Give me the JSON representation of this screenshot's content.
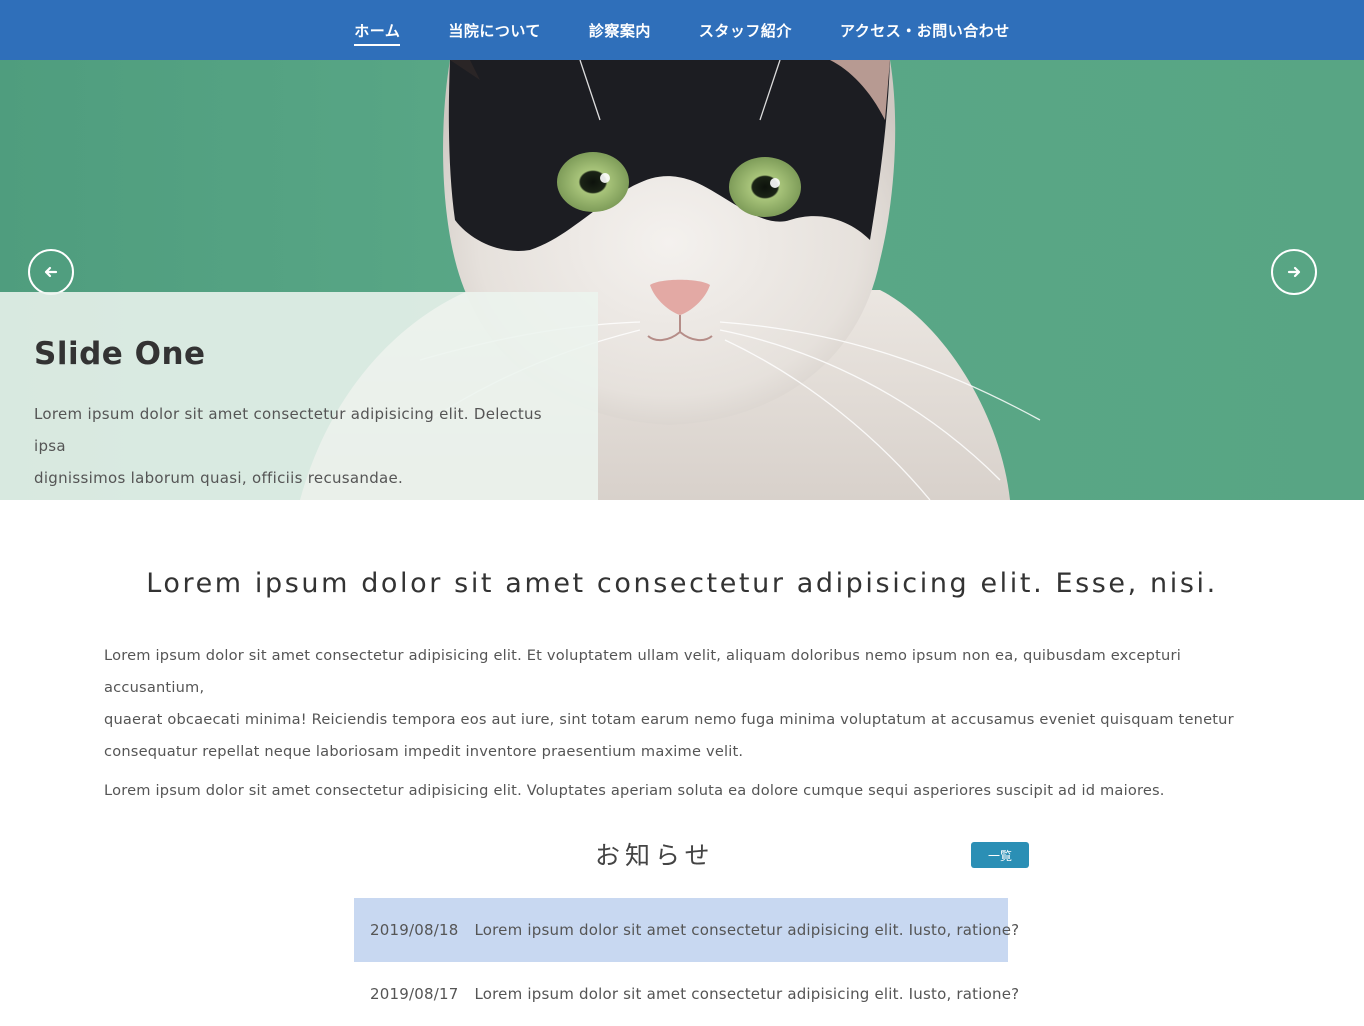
{
  "nav": {
    "items": [
      {
        "label": "ホーム",
        "active": true
      },
      {
        "label": "当院について",
        "active": false
      },
      {
        "label": "診察案内",
        "active": false
      },
      {
        "label": "スタッフ紹介",
        "active": false
      },
      {
        "label": "アクセス・お問い合わせ",
        "active": false
      }
    ]
  },
  "hero": {
    "slide_title": "Slide One",
    "slide_text_line1": "Lorem ipsum dolor sit amet consectetur adipisicing elit. Delectus ipsa",
    "slide_text_line2": "dignissimos laborum quasi, officiis recusandae.",
    "prev_icon": "arrow-left-icon",
    "next_icon": "arrow-right-icon"
  },
  "intro": {
    "heading": "Lorem ipsum dolor sit amet consectetur adipisicing elit. Esse, nisi.",
    "paragraph1_line1": "Lorem ipsum dolor sit amet consectetur adipisicing elit. Et voluptatem ullam velit, aliquam doloribus nemo ipsum non ea, quibusdam excepturi accusantium,",
    "paragraph1_line2": "quaerat obcaecati minima! Reiciendis tempora eos aut iure, sint totam earum nemo fuga minima voluptatum at accusamus eveniet quisquam tenetur",
    "paragraph1_line3": "consequatur repellat neque laboriosam impedit inventore praesentium maxime velit.",
    "paragraph2": "Lorem ipsum dolor sit amet consectetur adipisicing elit. Voluptates aperiam soluta ea dolore cumque sequi asperiores suscipit ad id maiores."
  },
  "news": {
    "heading": "お知らせ",
    "list_button": "一覧",
    "items": [
      {
        "date": "2019/08/18",
        "text": "Lorem ipsum dolor sit amet consectetur adipisicing elit. Iusto, ratione?"
      },
      {
        "date": "2019/08/17",
        "text": "Lorem ipsum dolor sit amet consectetur adipisicing elit. Iusto, ratione?"
      }
    ]
  },
  "colors": {
    "nav_bg": "#2f6fba",
    "hero_green": "#58a383",
    "news_highlight": "#c8d8f1",
    "button_teal": "#2b8fb5"
  }
}
